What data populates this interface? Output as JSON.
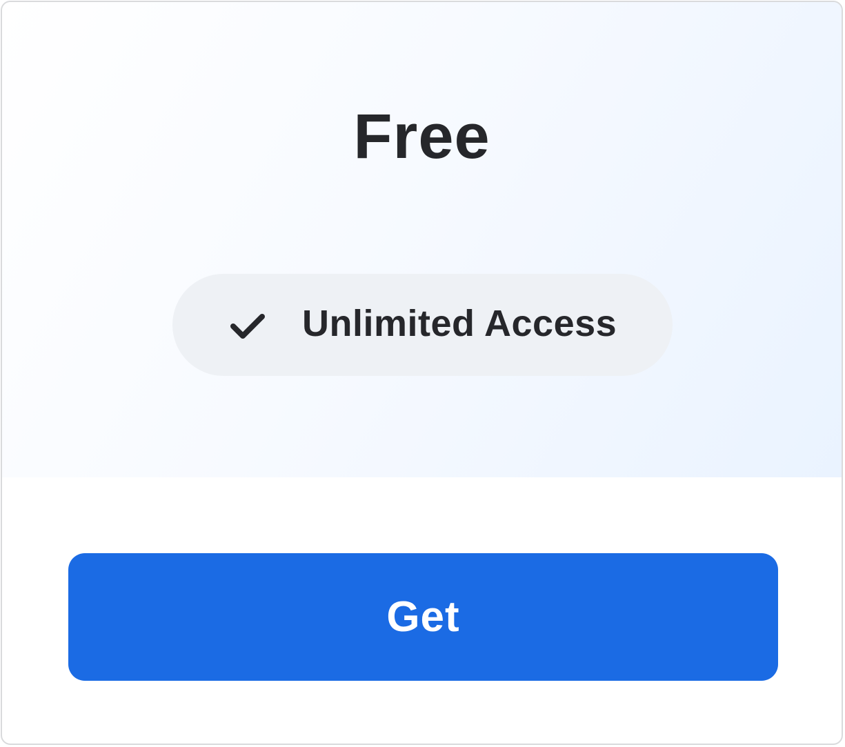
{
  "plan": {
    "title": "Free",
    "features": [
      {
        "icon": "check-icon",
        "label": "Unlimited Access"
      }
    ],
    "cta_label": "Get"
  },
  "colors": {
    "accent": "#1b6be4",
    "text": "#26272b",
    "pill_bg": "#eef1f5",
    "border": "#d9dadc"
  }
}
